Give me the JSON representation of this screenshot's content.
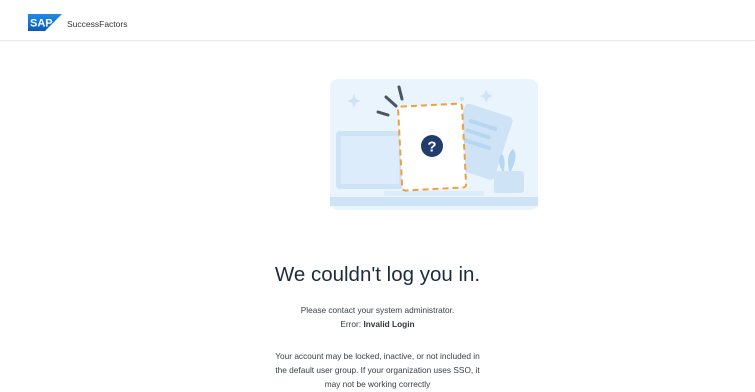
{
  "header": {
    "logo_text": "SAP",
    "brand_name": "SuccessFactors"
  },
  "illustration": {
    "icon": "question-mark-icon",
    "symbol": "?"
  },
  "message": {
    "title": "We couldn't log you in.",
    "contact": "Please contact your system administrator.",
    "error_prefix": "Error: ",
    "error_value": "Invalid Login",
    "details": [
      "Your account may be locked, inactive, or not included in",
      "the default user group. If your organization uses SSO, it",
      "may not be working correctly"
    ]
  },
  "colors": {
    "sap_blue": "#0a6ed1",
    "illustration_bg": "#eaf4fd",
    "frame_orange": "#f0a03c",
    "icon_navy": "#223d6b"
  }
}
